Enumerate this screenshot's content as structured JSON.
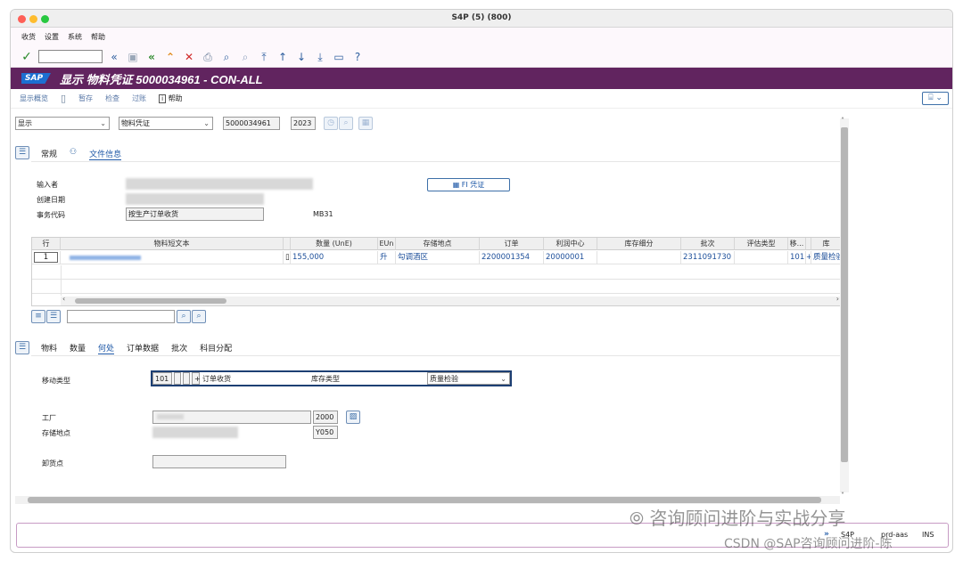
{
  "window": {
    "title": "S4P (5) (800)"
  },
  "menu": {
    "items": [
      "收货",
      "设置",
      "系统",
      "帮助"
    ]
  },
  "toolbar": {
    "cmd_value": ""
  },
  "titlearea": {
    "logo": "SAP",
    "title": "显示 物料凭证 5000034961 - CON-ALL"
  },
  "apptoolbar": {
    "overview": "显示概览",
    "hold": "暂存",
    "check": "检查",
    "post": "过账",
    "help": "帮助"
  },
  "header": {
    "action": "显示",
    "reference": "物料凭证",
    "doc_number": "5000034961",
    "year": "2023"
  },
  "doc_tabs": [
    "常规",
    "文件信息"
  ],
  "doc_info": {
    "entered_by_label": "输入者",
    "created_on_label": "创建日期",
    "trans_code_label": "事务代码",
    "trans_text": "按生产订单收货",
    "trans_code": "MB31",
    "fi_button": "FI 凭证"
  },
  "grid": {
    "headers": [
      "行",
      "物料短文本",
      "",
      "数量 (UnE)",
      "EUn",
      "存储地点",
      "订单",
      "利润中心",
      "库存细分",
      "批次",
      "评估类型",
      "移...",
      "",
      "库"
    ],
    "row": {
      "line": "1",
      "quantity": "155,000",
      "unit": "升",
      "sloc": "勾调酒区",
      "order": "2200001354",
      "profit_center": "20000001",
      "batch": "2311091730",
      "mvt": "101",
      "plus": "+",
      "stock_type": "质量检验"
    }
  },
  "item_tabs": [
    "物料",
    "数量",
    "何处",
    "订单数据",
    "批次",
    "科目分配"
  ],
  "where": {
    "mvt_label": "移动类型",
    "mvt_code": "101",
    "mvt_plus": "+",
    "mvt_text": "订单收货",
    "stock_type_label": "库存类型",
    "stock_type_value": "质量检验",
    "plant_label": "工厂",
    "plant_code": "2000",
    "sloc_label": "存储地点",
    "sloc_code": "Y050",
    "unloading_label": "卸货点"
  },
  "status": {
    "sap": "S4P",
    "server": "prd-aas",
    "mode": "INS"
  },
  "watermark": {
    "line1": "咨询顾问进阶与实战分享",
    "line2": "CSDN @SAP咨询顾问进阶-陈"
  },
  "colors": {
    "title_bg": "#61245f",
    "link": "#1d57a6",
    "traffic_red": "#fe5f57",
    "traffic_yellow": "#febc2e",
    "traffic_green": "#28c840"
  }
}
